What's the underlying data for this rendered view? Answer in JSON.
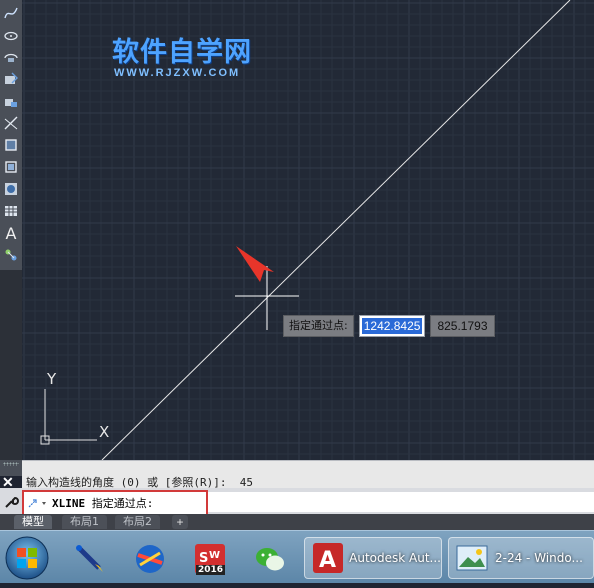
{
  "watermark": {
    "title": "软件自学网",
    "url": "WWW.RJZXW.COM"
  },
  "canvas": {
    "ucs": {
      "x_label": "X",
      "y_label": "Y"
    }
  },
  "dynamic_input": {
    "prompt": "指定通过点:",
    "x_value": "1242.8425",
    "y_value": "825.1793"
  },
  "command": {
    "history_line": "输入构造线的角度 (0) 或 [参照(R)]:  45",
    "current_command": "XLINE",
    "current_prompt": " 指定通过点:"
  },
  "tabs": [
    {
      "label": "模型",
      "active": true
    },
    {
      "label": "布局1",
      "active": false
    },
    {
      "label": "布局2",
      "active": false
    }
  ],
  "tabs_add": "+",
  "toolbar": {
    "text_tool": "A"
  },
  "taskbar": {
    "solidworks_badge": "2016",
    "autocad_window": "Autodesk Aut...",
    "image_window": "2-24 - Windo..."
  },
  "colors": {
    "canvas_bg": "#222936",
    "grid_minor": "#2a3240",
    "grid_major": "#323b4b",
    "xline": "#e8e8e8",
    "highlight_box": "#d23a3a",
    "selected_text": "#2a6ad7",
    "arrow": "#e8352a"
  }
}
